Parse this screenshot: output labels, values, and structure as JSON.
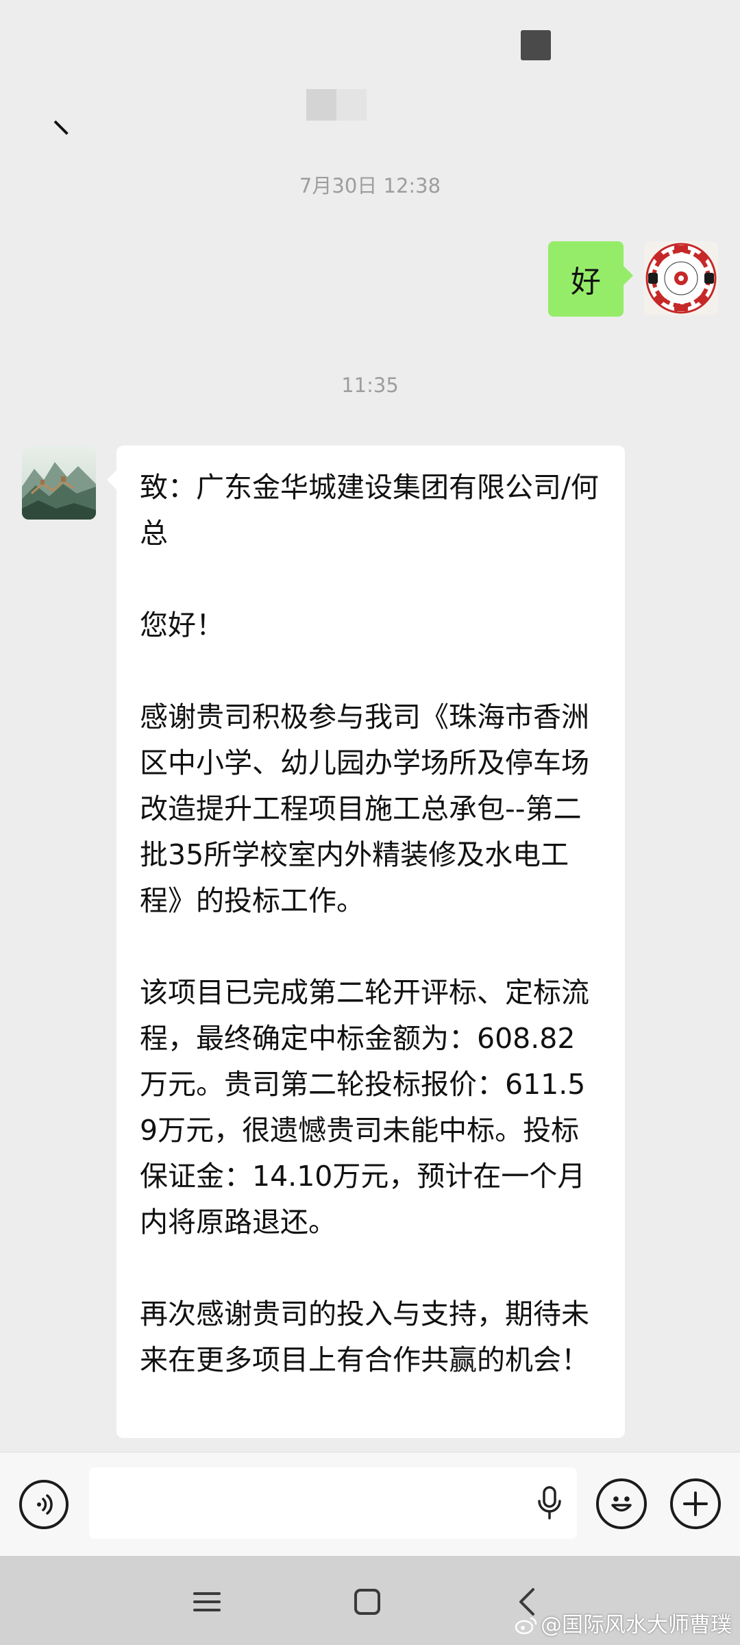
{
  "header": {
    "title": ""
  },
  "chat": {
    "messages": [
      {
        "type": "timestamp",
        "text": "7月30日 12:38"
      },
      {
        "type": "outgoing",
        "text": "好"
      },
      {
        "type": "timestamp",
        "text": "11:35"
      },
      {
        "type": "incoming",
        "paragraphs": [
          "致：广东金华城建设集团有限公司/何总",
          "您好！",
          "感谢贵司积极参与我司《珠海市香洲区中小学、幼儿园办学场所及停车场改造提升工程项目施工总承包--第二批35所学校室内外精装修及水电工程》的投标工作。",
          "该项目已完成第二轮开评标、定标流程，最终确定中标金额为：608.82万元。贵司第二轮投标报价：611.59万元，很遗憾贵司未能中标。投标保证金：14.10万元，预计在一个月内将原路退还。",
          "再次感谢贵司的投入与支持，期待未来在更多项目上有合作共赢的机会！"
        ]
      }
    ]
  },
  "input": {
    "placeholder": ""
  },
  "watermark": "@国际风水大师曹璞",
  "icons": {
    "voice": "voice-mode-icon",
    "mic": "microphone-icon",
    "emoji": "emoji-icon",
    "plus": "plus-icon",
    "nav_menu": "recent-apps-icon",
    "nav_home": "home-icon",
    "nav_back": "back-icon",
    "weibo": "weibo-icon"
  },
  "colors": {
    "background": "#ededed",
    "outgoing_bubble": "#95ec69",
    "incoming_bubble": "#ffffff",
    "timestamp_text": "#9d9d9d",
    "nav_bar": "#d2d2d2"
  }
}
